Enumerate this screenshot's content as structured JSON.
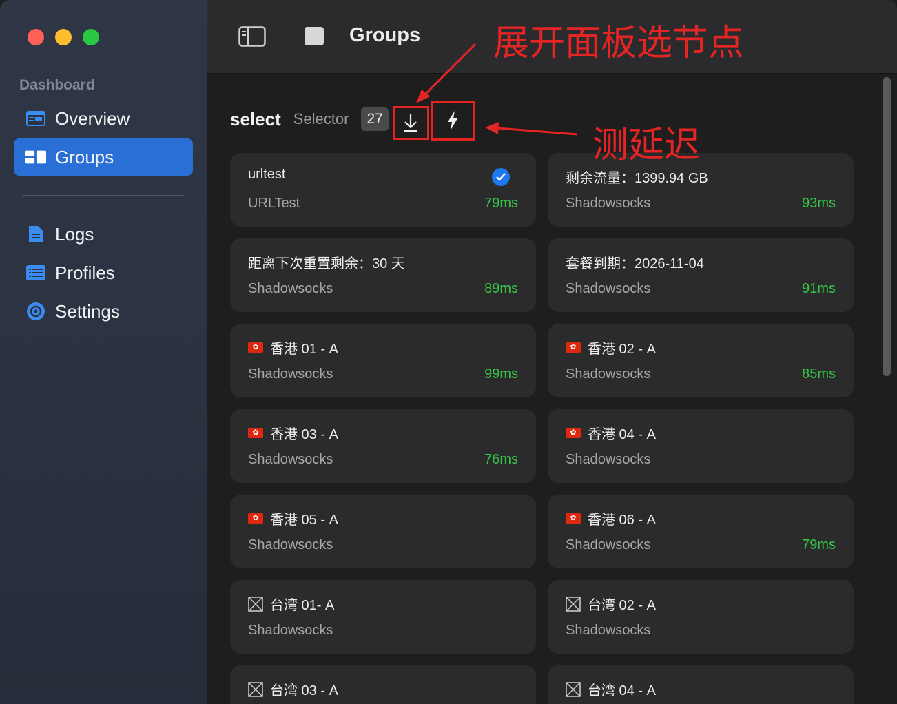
{
  "window": {
    "title": "Groups"
  },
  "sidebar": {
    "section_label": "Dashboard",
    "items": [
      {
        "label": "Overview",
        "icon": "overview-icon",
        "active": false
      },
      {
        "label": "Groups",
        "icon": "groups-icon",
        "active": true
      },
      {
        "label": "Logs",
        "icon": "logs-icon",
        "active": false
      },
      {
        "label": "Profiles",
        "icon": "profiles-icon",
        "active": false
      },
      {
        "label": "Settings",
        "icon": "settings-icon",
        "active": false
      }
    ]
  },
  "group": {
    "name": "select",
    "type": "Selector",
    "count": "27"
  },
  "annotations": {
    "expand": "展开面板选节点",
    "latency": "测延迟"
  },
  "colors": {
    "accent": "#2a6fd6",
    "delay_green": "#36c44a",
    "annotation_red": "#e52424"
  },
  "proxies": [
    {
      "name": "urltest",
      "type": "URLTest",
      "delay": "79ms",
      "flag": "",
      "selected": true
    },
    {
      "name": "剩余流量：1399.94 GB",
      "type": "Shadowsocks",
      "delay": "93ms",
      "flag": ""
    },
    {
      "name": "距离下次重置剩余：30 天",
      "type": "Shadowsocks",
      "delay": "89ms",
      "flag": ""
    },
    {
      "name": "套餐到期：2026-11-04",
      "type": "Shadowsocks",
      "delay": "91ms",
      "flag": ""
    },
    {
      "name": "香港 01 - A",
      "type": "Shadowsocks",
      "delay": "99ms",
      "flag": "hk"
    },
    {
      "name": "香港 02 - A",
      "type": "Shadowsocks",
      "delay": "85ms",
      "flag": "hk"
    },
    {
      "name": "香港 03 - A",
      "type": "Shadowsocks",
      "delay": "76ms",
      "flag": "hk"
    },
    {
      "name": "香港 04 - A",
      "type": "Shadowsocks",
      "delay": "",
      "flag": "hk"
    },
    {
      "name": "香港 05 - A",
      "type": "Shadowsocks",
      "delay": "",
      "flag": "hk"
    },
    {
      "name": "香港 06 - A",
      "type": "Shadowsocks",
      "delay": "79ms",
      "flag": "hk"
    },
    {
      "name": "台湾 01- A",
      "type": "Shadowsocks",
      "delay": "",
      "flag": "missing"
    },
    {
      "name": "台湾 02 - A",
      "type": "Shadowsocks",
      "delay": "",
      "flag": "missing"
    },
    {
      "name": "台湾 03 - A",
      "type": "",
      "delay": "",
      "flag": "missing"
    },
    {
      "name": "台湾 04 - A",
      "type": "",
      "delay": "",
      "flag": "missing"
    }
  ]
}
